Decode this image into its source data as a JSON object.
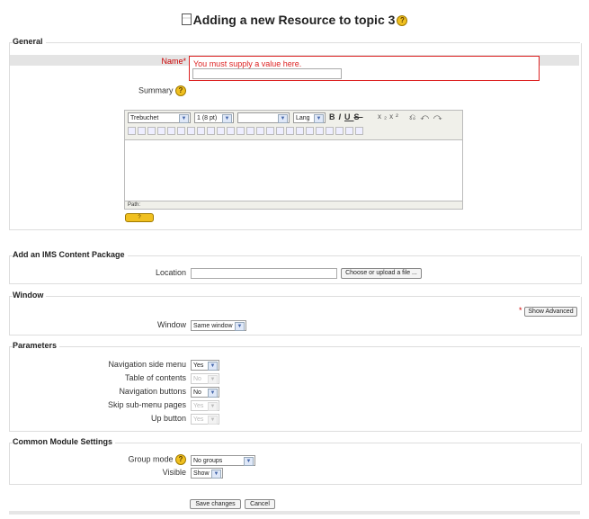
{
  "page": {
    "title": "Adding a new Resource to topic 3"
  },
  "sections": {
    "general": "General",
    "ims": "Add an IMS Content Package",
    "window": "Window",
    "parameters": "Parameters",
    "common": "Common Module Settings"
  },
  "general": {
    "name_label": "Name",
    "name_required_mark": "*",
    "name_error": "You must supply a value here.",
    "name_value": "",
    "summary_label": "Summary",
    "editor": {
      "font": "Trebuchet",
      "size": "1 (8 pt)",
      "format": "",
      "lang": "Lang",
      "path_label": "Path:"
    },
    "help_badge": "?"
  },
  "ims": {
    "location_label": "Location",
    "location_value": "",
    "choose_button": "Choose or upload a file ..."
  },
  "window": {
    "advanced_mark": "*",
    "show_advanced_button": "Show Advanced",
    "window_label": "Window",
    "window_value": "Same window"
  },
  "parameters": {
    "rows": [
      {
        "label": "Navigation side menu",
        "value": "Yes",
        "disabled": false
      },
      {
        "label": "Table of contents",
        "value": "No",
        "disabled": true
      },
      {
        "label": "Navigation buttons",
        "value": "No",
        "disabled": false
      },
      {
        "label": "Skip sub-menu pages",
        "value": "Yes",
        "disabled": true
      },
      {
        "label": "Up button",
        "value": "Yes",
        "disabled": true
      }
    ]
  },
  "common": {
    "group_mode_label": "Group mode",
    "group_mode_value": "No groups",
    "visible_label": "Visible",
    "visible_value": "Show"
  },
  "actions": {
    "save": "Save changes",
    "cancel": "Cancel"
  },
  "icons": {
    "help": "help-icon",
    "dropdown": "chevron-down-icon"
  }
}
